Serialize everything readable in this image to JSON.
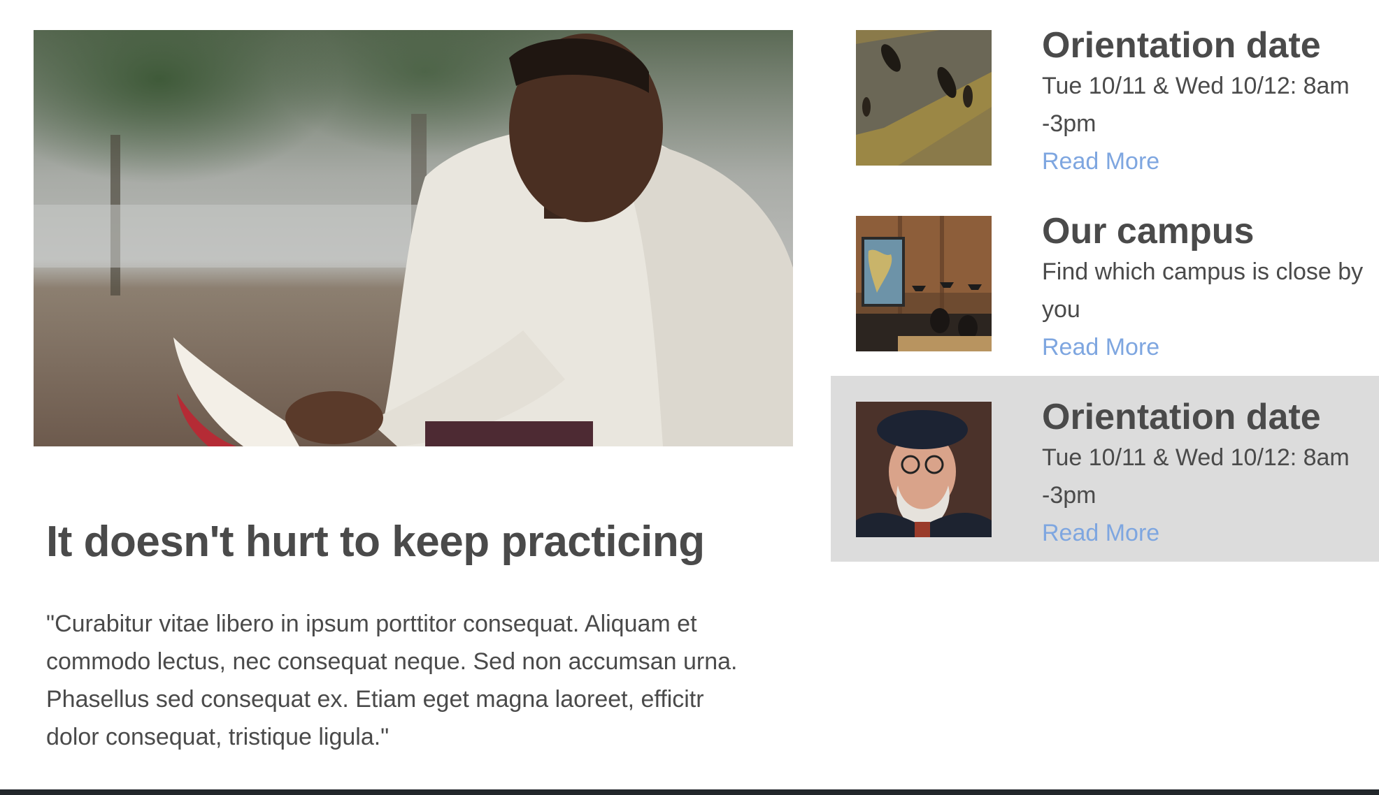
{
  "hero": {
    "image": "man-reading-book-photo"
  },
  "headline": "It doesn't hurt to keep practicing",
  "quote": "\"Curabitur vitae libero in ipsum porttitor consequat. Aliquam et commodo lectus, nec consequat neque. Sed non accumsan urna. Phasellus sed consequat ex. Etiam eget magna laoreet, efficitr dolor consequat, tristique ligula.\"",
  "cards": [
    {
      "image": "people-walking-aerial-photo",
      "title": "Orientation date",
      "desc": "Tue 10/11 & Wed 10/12: 8am -3pm",
      "link": "Read More",
      "active": false
    },
    {
      "image": "campus-cafe-photo",
      "title": "Our campus",
      "desc": "Find which campus is close by you",
      "link": "Read More",
      "active": false
    },
    {
      "image": "old-man-beret-photo",
      "title": "Orientation date",
      "desc": "Tue 10/11 & Wed 10/12: 8am -3pm",
      "link": "Read More",
      "active": true
    }
  ],
  "colors": {
    "text": "#4a4a4a",
    "link": "#7ea6e0",
    "active_card_bg": "#dcdcdc",
    "footer_bar": "#22272b"
  }
}
